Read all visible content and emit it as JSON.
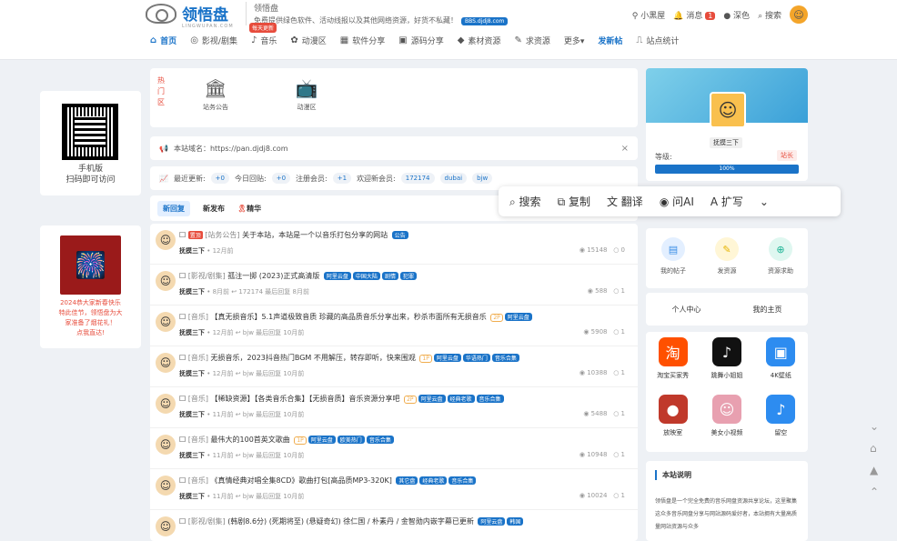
{
  "header": {
    "logo_text": "领悟盘",
    "logo_sub": "LINGWUPAN.COM",
    "site_name": "领悟盘",
    "site_desc": "免费提供绿色软件、活动线报以及其他网络资源，好货不私藏！",
    "bbs_badge": "BBS.djdj8.com",
    "user_name": "小黑屋",
    "msg_label": "消息",
    "msg_count": "1",
    "theme_label": "深色",
    "search_label": "搜索"
  },
  "nav": {
    "items": [
      {
        "label": "首页",
        "icon": "home-icon"
      },
      {
        "label": "影视/剧集",
        "icon": "film-icon"
      },
      {
        "label": "音乐",
        "icon": "music-icon",
        "hot": "每天更新"
      },
      {
        "label": "动漫区",
        "icon": "anime-icon"
      },
      {
        "label": "软件分享",
        "icon": "software-icon"
      },
      {
        "label": "源码分享",
        "icon": "code-icon"
      },
      {
        "label": "素材资源",
        "icon": "material-icon"
      },
      {
        "label": "求资源",
        "icon": "request-icon"
      },
      {
        "label": "更多▾",
        "icon": ""
      },
      {
        "label": "发新帖",
        "icon": ""
      },
      {
        "label": "站点统计",
        "icon": "chart-icon"
      }
    ]
  },
  "sidebar_left": {
    "qr_line1": "手机版",
    "qr_line2": "扫码即可访问",
    "ad_line1": "2024恭大家新春快乐",
    "ad_line2": "特此佳节，领悟盘为大",
    "ad_line3": "家准备了烟花礼！",
    "ad_line4": "点我直达!"
  },
  "quick": {
    "hot_label": "热门区",
    "items": [
      {
        "label": "站务公告"
      },
      {
        "label": "动漫区"
      }
    ]
  },
  "domain_bar": {
    "text": "本站域名：https://pan.djdj8.com",
    "close": "×"
  },
  "stats": {
    "label": "最近更新:",
    "recent": "+0",
    "today_label": "今日回贴:",
    "today": "+0",
    "reg_label": "注册会员:",
    "reg": "+1",
    "welcome_label": "欢迎新会员:",
    "members": [
      "172174",
      "dubai",
      "bjw"
    ]
  },
  "tabs": [
    {
      "label": "新回复"
    },
    {
      "label": "新发布"
    },
    {
      "label": "精华"
    }
  ],
  "selection_toolbar": [
    {
      "label": "搜索",
      "icon": "search-icon"
    },
    {
      "label": "复制",
      "icon": "copy-icon"
    },
    {
      "label": "翻译",
      "icon": "translate-icon"
    },
    {
      "label": "问AI",
      "icon": "ai-icon"
    },
    {
      "label": "扩写",
      "icon": "expand-icon"
    },
    {
      "label": "⌄",
      "icon": "chevron-down-icon"
    }
  ],
  "threads": [
    {
      "new": "置顶",
      "cat": "[站务公告]",
      "title": "关于本站，本站是一个以音乐打包分享的网站",
      "tags": [
        "公告"
      ],
      "author": "抚摸三下",
      "meta": "• 12月前",
      "views": "15148",
      "replies": "0"
    },
    {
      "new": "",
      "cat": "[影视/剧集]",
      "title": "孤注一掷 (2023)正式高清版",
      "tags": [
        "阿里云盘",
        "中国大陆",
        "剧情",
        "犯罪"
      ],
      "author": "抚摸三下",
      "meta": "• 8月前 ↩ 172174 最后回复 8月前",
      "views": "588",
      "replies": "1"
    },
    {
      "new": "",
      "cat": "[音乐]",
      "title": "【真无损音乐】5.1声道极致音质 珍藏的高品质音乐分享出来，秒杀市面所有无损音乐",
      "tags": [
        "2P",
        "阿里云盘"
      ],
      "author": "抚摸三下",
      "meta": "• 12月前 ↩ bjw 最后回复 10月前",
      "views": "5908",
      "replies": "1"
    },
    {
      "new": "",
      "cat": "[音乐]",
      "title": "无损音乐，2023抖音热门BGM 不用解压，转存即听，快来围观",
      "tags": [
        "1P",
        "阿里云盘",
        "华语热门",
        "音乐合集"
      ],
      "author": "抚摸三下",
      "meta": "• 12月前 ↩ bjw 最后回复 10月前",
      "views": "10388",
      "replies": "1"
    },
    {
      "new": "",
      "cat": "[音乐]",
      "title": "【稀缺资源】【各类音乐合集】【无损音质】音乐资源分享吧",
      "tags": [
        "2P",
        "阿里云盘",
        "经典老歌",
        "音乐合集"
      ],
      "author": "抚摸三下",
      "meta": "• 11月前 ↩ bjw 最后回复 10月前",
      "views": "5488",
      "replies": "1"
    },
    {
      "new": "",
      "cat": "[音乐]",
      "title": "最伟大的100首英文歌曲",
      "tags": [
        "1P",
        "阿里云盘",
        "欧美热门",
        "音乐合集"
      ],
      "author": "抚摸三下",
      "meta": "• 11月前 ↩ bjw 最后回复 10月前",
      "views": "10948",
      "replies": "1"
    },
    {
      "new": "",
      "cat": "[音乐]",
      "title": "《真情经典对唱全集8CD》歌曲打包[高品质MP3-320K]",
      "tags": [
        "其它盘",
        "经典老歌",
        "音乐合集"
      ],
      "author": "抚摸三下",
      "meta": "• 11月前 ↩ bjw 最后回复 10月前",
      "views": "10024",
      "replies": "1"
    },
    {
      "new": "",
      "cat": "[影视/剧集]",
      "title": "(韩剧8.6分) (死期将至) (悬疑奇幻) 徐仁国 / 朴素丹 / 金智勋内嵌字幕已更新",
      "tags": [
        "阿里云盘",
        "韩国"
      ],
      "author": "",
      "meta": "",
      "views": "",
      "replies": ""
    }
  ],
  "profile": {
    "name": "抚摸三下",
    "level_label": "等级:",
    "role": "站长",
    "progress_text": "100%",
    "progress": 100
  },
  "actions": [
    {
      "label": "我的帖子",
      "icon": "doc-icon",
      "color": "#3a8ee6",
      "bg": "#e3efff"
    },
    {
      "label": "发资源",
      "icon": "edit-icon",
      "color": "#e6b400",
      "bg": "#fff6d6"
    },
    {
      "label": "资源求助",
      "icon": "help-icon",
      "color": "#1bb394",
      "bg": "#dff7f0"
    }
  ],
  "links": [
    {
      "label": "个人中心"
    },
    {
      "label": "我的主页"
    }
  ],
  "apps": [
    {
      "label": "淘宝买家秀",
      "icon": "taobao-icon",
      "color": "#ff5000",
      "glyph": "淘"
    },
    {
      "label": "跳舞小姐姐",
      "icon": "tiktok-icon",
      "color": "#111111",
      "glyph": "♪"
    },
    {
      "label": "4K壁纸",
      "icon": "wallpaper-icon",
      "color": "#2d8cf0",
      "glyph": "▣"
    },
    {
      "label": "放映室",
      "icon": "cinema-icon",
      "color": "#c0392b",
      "glyph": "●"
    },
    {
      "label": "美女小视频",
      "icon": "video-icon",
      "color": "#e8a0b0",
      "glyph": "☺"
    },
    {
      "label": "留空",
      "icon": "blank-icon",
      "color": "#2d8cf0",
      "glyph": "♪"
    }
  ],
  "about": {
    "title": "本站说明",
    "text": "领悟盘是一个完全免费的音乐网盘资源共享论坛，这里聚集这众多音乐网盘分享与网站源码爱好者，本站拥有大量高质量网站资源与众多"
  }
}
